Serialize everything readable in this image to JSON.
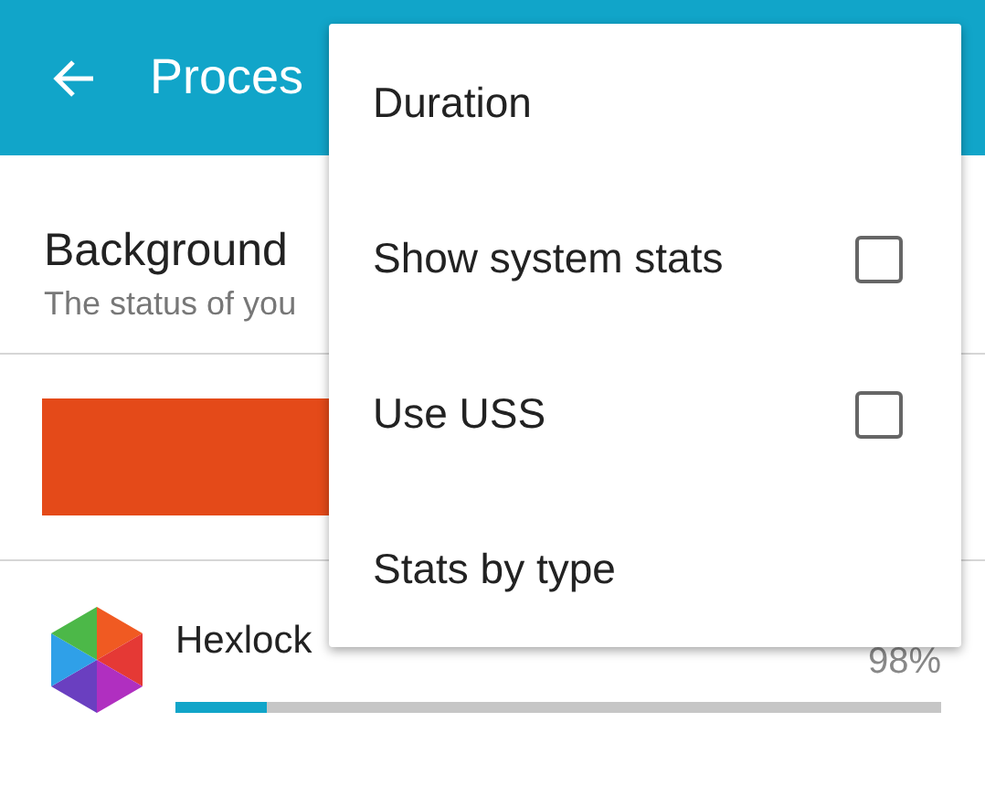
{
  "toolbar": {
    "title": "Proces"
  },
  "section": {
    "title": "Background",
    "subtitle": "The status of you"
  },
  "apps": [
    {
      "name": "Hexlock",
      "percent": "98%",
      "level": 0.12
    }
  ],
  "menu": {
    "items": [
      {
        "kind": "plain",
        "label": "Duration"
      },
      {
        "kind": "checkbox",
        "label": "Show system stats",
        "checked": false
      },
      {
        "kind": "checkbox",
        "label": "Use USS",
        "checked": false
      },
      {
        "kind": "plain",
        "label": "Stats by type"
      }
    ]
  }
}
